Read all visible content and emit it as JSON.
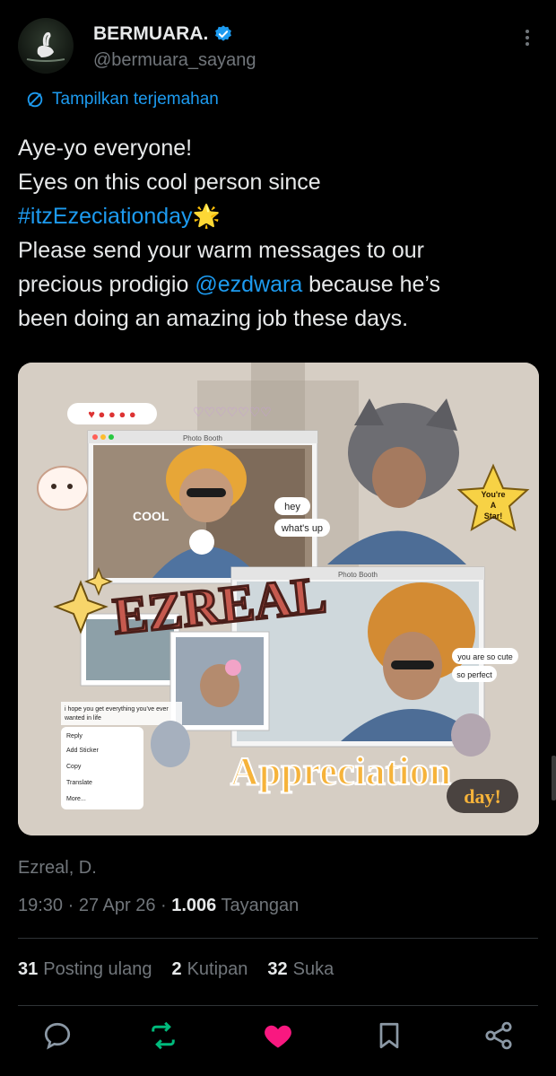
{
  "author": {
    "display_name": "BERMUARA.",
    "handle": "@bermuara_sayang",
    "verified": true,
    "avatar_icon": "swan-avatar"
  },
  "translate_label": "Tampilkan terjemahan",
  "tweet": {
    "line1": "Aye-yo everyone!",
    "line2": "Eyes on this cool person since",
    "hashtag": "#itzEzeciationday",
    "hashtag_emoji": "🌟",
    "line4": "Please send your warm messages to our",
    "line5_prefix": "precious prodigio ",
    "mention": "@ezdwara",
    "line5_suffix": " because he’s",
    "line6": "been doing an amazing job these days."
  },
  "media": {
    "title_word": "EZREAL",
    "subtitle": "Appreciation",
    "day": "day!",
    "cool": "COOL",
    "bubble_hey": "hey",
    "bubble_whats_up": "what's up",
    "bubble_cute": "you are so cute",
    "bubble_perfect": "so perfect",
    "star_text_1": "You're",
    "star_text_2": "A",
    "star_text_3": "Star!",
    "window_title_1": "Photo Booth",
    "window_title_2": "Photo Booth",
    "wish_line_1": "i hope you get everything you've ever",
    "wish_line_2": "wanted in life",
    "menu": [
      "Reply",
      "Add Sticker",
      "Copy",
      "Translate",
      "More..."
    ]
  },
  "signature": "Ezreal, D.",
  "meta": {
    "time": "19:30",
    "date": "27 Apr 26",
    "views_count": "1.006",
    "views_label": "Tayangan"
  },
  "stats": {
    "reposts_count": "31",
    "reposts_label": "Posting ulang",
    "quotes_count": "2",
    "quotes_label": "Kutipan",
    "likes_count": "32",
    "likes_label": "Suka"
  },
  "colors": {
    "accent": "#1d9bf0",
    "repost_active": "#00ba7c",
    "like_active": "#f91880",
    "muted": "#71767b"
  }
}
